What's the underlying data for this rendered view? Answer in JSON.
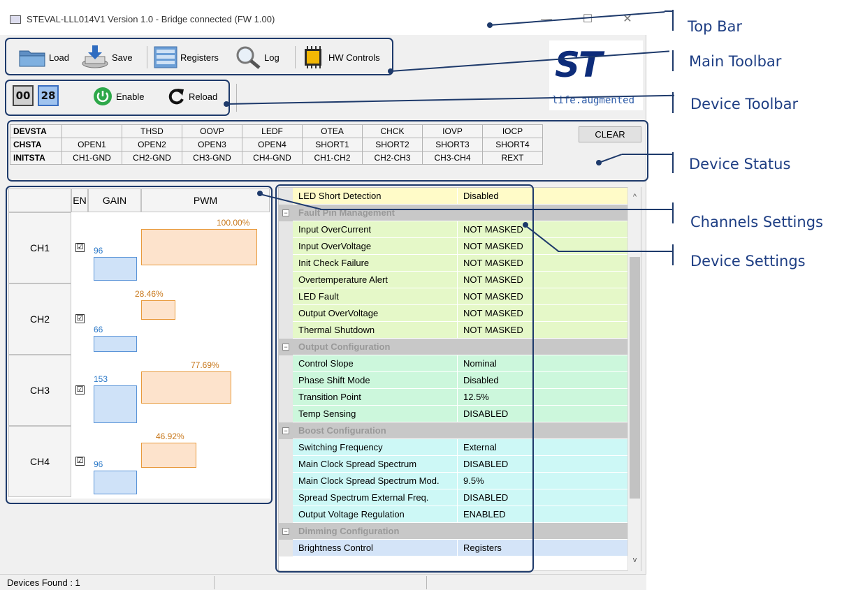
{
  "window": {
    "title": "STEVAL-LLL014V1 Version 1.0 - Bridge connected (FW 1.00)",
    "controls": {
      "minimize": "—",
      "maximize": "☐",
      "close": "✕"
    }
  },
  "main_toolbar": {
    "load": "Load",
    "save": "Save",
    "registers": "Registers",
    "log": "Log",
    "hw_controls": "HW Controls"
  },
  "logo": {
    "mark": "ST",
    "tagline": "life.augmented"
  },
  "device_toolbar": {
    "device_a": "00",
    "device_b": "28",
    "enable": "Enable",
    "reload": "Reload"
  },
  "device_status": {
    "rows": [
      {
        "name": "DEVSTA",
        "cells": [
          "",
          "THSD",
          "OOVP",
          "LEDF",
          "OTEA",
          "CHCK",
          "IOVP",
          "IOCP"
        ]
      },
      {
        "name": "CHSTA",
        "cells": [
          "OPEN1",
          "OPEN2",
          "OPEN3",
          "OPEN4",
          "SHORT1",
          "SHORT2",
          "SHORT3",
          "SHORT4"
        ]
      },
      {
        "name": "INITSTA",
        "cells": [
          "CH1-GND",
          "CH2-GND",
          "CH3-GND",
          "CH4-GND",
          "CH1-CH2",
          "CH2-CH3",
          "CH3-CH4",
          "REXT"
        ]
      }
    ],
    "clear": "CLEAR"
  },
  "channels": {
    "headers": {
      "en": "EN",
      "gain": "GAIN",
      "pwm": "PWM"
    },
    "gain_max": 255,
    "items": [
      {
        "name": "CH1",
        "enabled": "☑",
        "gain": 96,
        "pwm_label": "100.00%",
        "pwm_fraction": 1.0
      },
      {
        "name": "CH2",
        "enabled": "☑",
        "gain": 66,
        "pwm_label": "28.46%",
        "pwm_fraction": 0.2846
      },
      {
        "name": "CH3",
        "enabled": "☑",
        "gain": 153,
        "pwm_label": "77.69%",
        "pwm_fraction": 0.7769
      },
      {
        "name": "CH4",
        "enabled": "☑",
        "gain": 96,
        "pwm_label": "46.92%",
        "pwm_fraction": 0.4692
      }
    ]
  },
  "settings": {
    "collapse_symbol": "−",
    "rows": [
      {
        "type": "item",
        "key": "LED Short Detection",
        "value": "Disabled",
        "color": "#fffbc8"
      },
      {
        "type": "cat",
        "key": "Fault Pin Management"
      },
      {
        "type": "item",
        "key": "Input OverCurrent",
        "value": "NOT MASKED",
        "color": "#e5f8c8"
      },
      {
        "type": "item",
        "key": "Input OverVoltage",
        "value": "NOT MASKED",
        "color": "#e5f8c8"
      },
      {
        "type": "item",
        "key": "Init Check Failure",
        "value": "NOT MASKED",
        "color": "#e5f8c8"
      },
      {
        "type": "item",
        "key": "Overtemperature Alert",
        "value": "NOT MASKED",
        "color": "#e5f8c8"
      },
      {
        "type": "item",
        "key": "LED Fault",
        "value": "NOT MASKED",
        "color": "#e5f8c8"
      },
      {
        "type": "item",
        "key": "Output OverVoltage",
        "value": "NOT MASKED",
        "color": "#e5f8c8"
      },
      {
        "type": "item",
        "key": "Thermal Shutdown",
        "value": "NOT MASKED",
        "color": "#e5f8c8"
      },
      {
        "type": "cat",
        "key": "Output Configuration"
      },
      {
        "type": "item",
        "key": "Control Slope",
        "value": "Nominal",
        "color": "#ccf7dc"
      },
      {
        "type": "item",
        "key": "Phase Shift Mode",
        "value": "Disabled",
        "color": "#ccf7dc"
      },
      {
        "type": "item",
        "key": "Transition Point",
        "value": "12.5%",
        "color": "#ccf7dc"
      },
      {
        "type": "item",
        "key": "Temp Sensing",
        "value": "DISABLED",
        "color": "#ccf7dc"
      },
      {
        "type": "cat",
        "key": "Boost Configuration"
      },
      {
        "type": "item",
        "key": "Switching Frequency",
        "value": "External",
        "color": "#cdf8f6"
      },
      {
        "type": "item",
        "key": "Main Clock Spread Spectrum",
        "value": "DISABLED",
        "color": "#cdf8f6"
      },
      {
        "type": "item",
        "key": "Main Clock Spread Spectrum Mod.",
        "value": "9.5%",
        "color": "#cdf8f6"
      },
      {
        "type": "item",
        "key": "Spread Spectrum External Freq.",
        "value": "DISABLED",
        "color": "#cdf8f6"
      },
      {
        "type": "item",
        "key": "Output Voltage Regulation",
        "value": "ENABLED",
        "color": "#cdf8f6"
      },
      {
        "type": "cat",
        "key": "Dimming Configuration"
      },
      {
        "type": "item",
        "key": "Brightness Control",
        "value": "Registers",
        "color": "#d4e4f8"
      }
    ]
  },
  "scrollbar": {
    "up": "^",
    "down": "v"
  },
  "status_bar": {
    "text": "Devices Found : 1"
  },
  "annotations": {
    "top_bar": "Top Bar",
    "main_toolbar": "Main Toolbar",
    "device_toolbar": "Device Toolbar",
    "device_status": "Device Status",
    "channels_settings": "Channels Settings",
    "device_settings": "Device Settings"
  },
  "colors": {
    "annotation": "#1f3f84",
    "highlight": "#1e3a6b",
    "gain_bar": "#cfe2f8",
    "pwm_bar": "#fde3cc"
  }
}
